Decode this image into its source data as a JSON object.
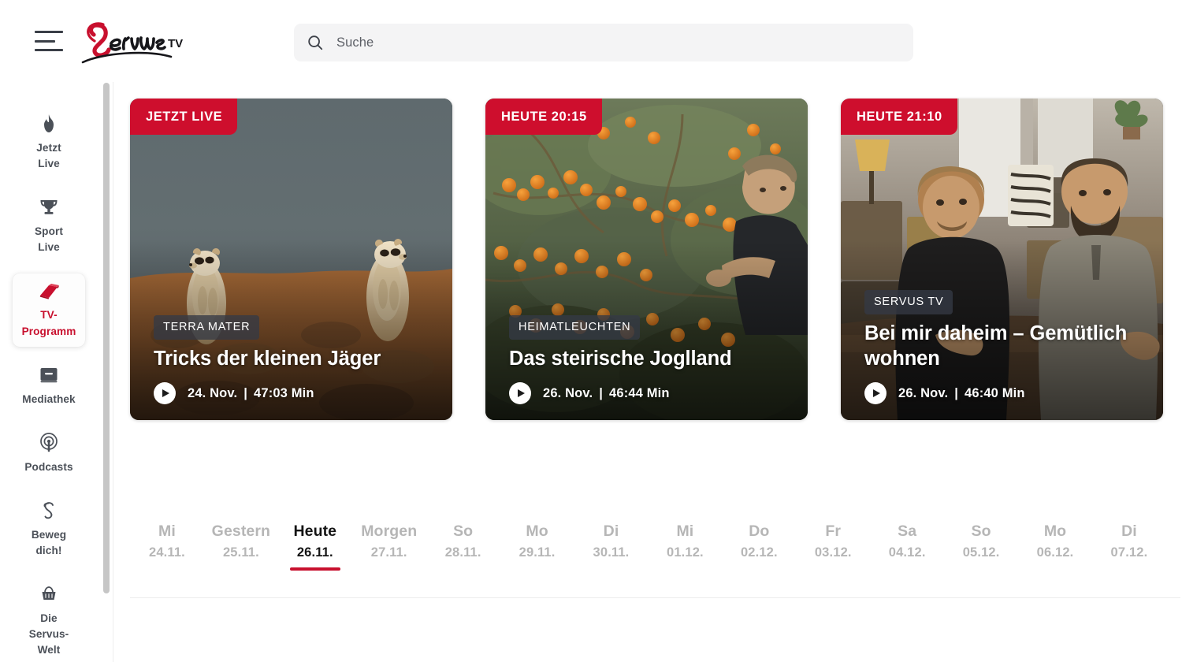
{
  "header": {
    "menu_icon": "hamburger-icon",
    "logo": {
      "script_text": "Servus",
      "suffix": "TV",
      "accent": "#c8102e"
    },
    "search": {
      "icon": "search-icon",
      "placeholder": "Suche",
      "value": ""
    }
  },
  "sidebar": {
    "items": [
      {
        "icon": "flame-icon",
        "label": "Jetzt\nLive",
        "active": false
      },
      {
        "icon": "trophy-icon",
        "label": "Sport\nLive",
        "active": false
      },
      {
        "icon": "book-icon",
        "label": "TV-\nProgramm",
        "active": true
      },
      {
        "icon": "monitor-icon",
        "label": "Mediathek",
        "active": false
      },
      {
        "icon": "podcast-icon",
        "label": "Podcasts",
        "active": false
      },
      {
        "icon": "swirl-s-icon",
        "label": "Beweg\ndich!",
        "active": false
      },
      {
        "icon": "basket-icon",
        "label": "Die\nServus-\nWelt",
        "active": false
      }
    ],
    "active_color": "#c8102e",
    "label_color": "#4b5058"
  },
  "cards": [
    {
      "time_badge": "JETZT LIVE",
      "genre": "TERRA MATER",
      "title": "Tricks der kleinen Jäger",
      "date": "24. Nov.",
      "separator": "|",
      "duration": "47:03 Min",
      "play_icon": "play-icon",
      "image_alt": "meerkats-standing-desert"
    },
    {
      "time_badge": "HEUTE 20:15",
      "genre": "HEIMATLEUCHTEN",
      "title": "Das steirische Joglland",
      "date": "26. Nov.",
      "separator": "|",
      "duration": "46:44 Min",
      "play_icon": "play-icon",
      "image_alt": "sea-buckthorn-bush-woman-harvesting"
    },
    {
      "time_badge": "HEUTE 21:10",
      "genre": "SERVUS TV",
      "title": "Bei mir daheim – Gemütlich wohnen",
      "date": "26. Nov.",
      "separator": "|",
      "duration": "46:40 Min",
      "play_icon": "play-icon",
      "image_alt": "two-men-in-furniture-workshop"
    }
  ],
  "date_strip": {
    "accent": "#c8102e",
    "days": [
      {
        "day": "Mi",
        "date": "24.11.",
        "active": false
      },
      {
        "day": "Gestern",
        "date": "25.11.",
        "active": false
      },
      {
        "day": "Heute",
        "date": "26.11.",
        "active": true
      },
      {
        "day": "Morgen",
        "date": "27.11.",
        "active": false
      },
      {
        "day": "So",
        "date": "28.11.",
        "active": false
      },
      {
        "day": "Mo",
        "date": "29.11.",
        "active": false
      },
      {
        "day": "Di",
        "date": "30.11.",
        "active": false
      },
      {
        "day": "Mi",
        "date": "01.12.",
        "active": false
      },
      {
        "day": "Do",
        "date": "02.12.",
        "active": false
      },
      {
        "day": "Fr",
        "date": "03.12.",
        "active": false
      },
      {
        "day": "Sa",
        "date": "04.12.",
        "active": false
      },
      {
        "day": "So",
        "date": "05.12.",
        "active": false
      },
      {
        "day": "Mo",
        "date": "06.12.",
        "active": false
      },
      {
        "day": "Di",
        "date": "07.12.",
        "active": false
      }
    ]
  },
  "scrollbar": {
    "orientation": "vertical",
    "icon": "scrollbar-thumb"
  }
}
